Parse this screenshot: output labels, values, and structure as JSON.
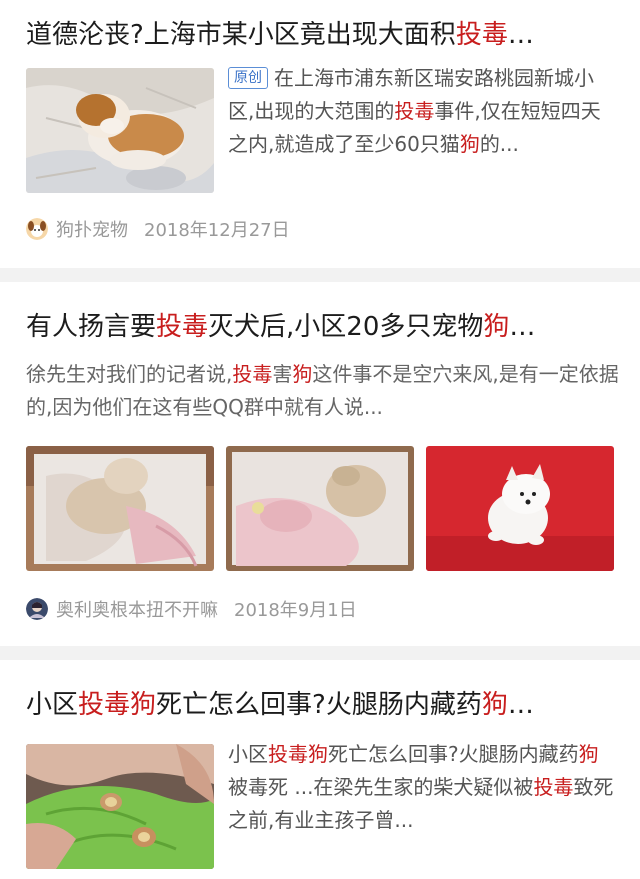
{
  "results": [
    {
      "title_parts": [
        "道德沦丧?上海市某小区竟出现大面积",
        "投毒",
        "…"
      ],
      "badge": "原创",
      "snippet_parts": [
        "在上海市浦东新区瑞安路桃园新城小区,出现的大范围的",
        "投毒",
        "事件,仅在短短四天之内,就造成了至少60只猫",
        "狗",
        "的..."
      ],
      "source": "狗扑宠物",
      "date": "2018年12月27日",
      "images": [
        "puppy-on-sheet-photo"
      ]
    },
    {
      "title_parts": [
        "有人扬言要",
        "投毒",
        "灭犬后,小区20多只宠物",
        "狗",
        "…"
      ],
      "snippet_parts": [
        "徐先生对我们的记者说,",
        "投毒",
        "害",
        "狗",
        "这件事不是空穴来风,是有一定依据的,因为他们在这有些QQ群中就有人说..."
      ],
      "source": "奥利奥根本扭不开嘛",
      "date": "2018年9月1日",
      "images": [
        "poisoned-dog-photo-1",
        "poisoned-dog-photo-2",
        "white-puppy-red-background-photo"
      ]
    },
    {
      "title_parts": [
        "小区",
        "投毒狗",
        "死亡怎么回事?火腿肠内藏药",
        "狗",
        "…"
      ],
      "snippet_parts": [
        "小区",
        "投毒狗",
        "死亡怎么回事?火腿肠内藏药",
        "狗",
        "被毒死 ...在梁先生家的柴犬疑似被",
        "投毒",
        "致死之前,有业主孩子曾..."
      ],
      "images": [
        "poisoned-sausage-in-hand-photo"
      ]
    }
  ],
  "colors": {
    "highlight": "#c81e1e",
    "badge": "#3b73c8",
    "meta": "#999999",
    "separator": "#f2f2f2"
  }
}
